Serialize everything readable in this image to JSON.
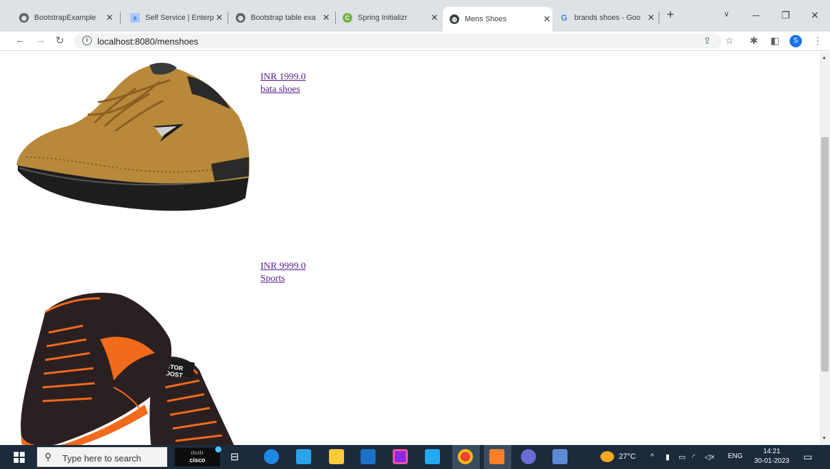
{
  "browser": {
    "tabs": [
      {
        "label": "BootstrapExample",
        "active": false
      },
      {
        "label": "Self Service | Enterp",
        "active": false
      },
      {
        "label": "Bootstrap table exa",
        "active": false
      },
      {
        "label": "Spring Initializr",
        "active": false
      },
      {
        "label": "Mens Shoes",
        "active": true
      },
      {
        "label": "brands shoes - Goo",
        "active": false
      }
    ],
    "new_tab_label": "+",
    "url": "localhost:8080/menshoes"
  },
  "products": [
    {
      "price": "INR 1999.0",
      "name": "bata shoes"
    },
    {
      "price": "INR 9999.0",
      "name": "Sports"
    }
  ],
  "taskbar": {
    "search_placeholder": "Type here to search",
    "cisco_label": "cisco",
    "weather": "27°C",
    "language": "ENG",
    "time": "14:21",
    "date": "30-01-2023"
  }
}
